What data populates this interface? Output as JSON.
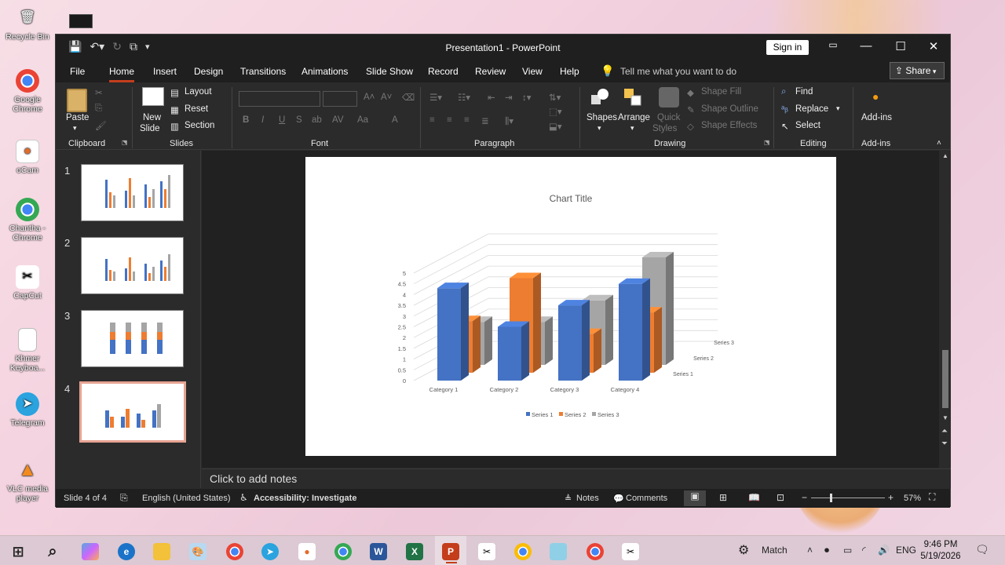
{
  "desktop": {
    "icons": [
      {
        "label": "Recycle Bin",
        "icon": "recycle-bin-icon"
      },
      {
        "label": "Google Chrome",
        "icon": "chrome-icon"
      },
      {
        "label": "oCam",
        "icon": "ocam-icon"
      },
      {
        "label": "Chantha - Chrome",
        "icon": "chrome-profile-icon"
      },
      {
        "label": "CapCut",
        "icon": "capcut-icon"
      },
      {
        "label": "Khmer Keyboa...",
        "icon": "document-icon"
      },
      {
        "label": "Telegram",
        "icon": "telegram-icon"
      },
      {
        "label": "VLC media player",
        "icon": "vlc-icon"
      }
    ]
  },
  "window": {
    "title": "Presentation1  -  PowerPoint",
    "sign_in": "Sign in",
    "share": "Share",
    "tabs": [
      "File",
      "Home",
      "Insert",
      "Design",
      "Transitions",
      "Animations",
      "Slide Show",
      "Record",
      "Review",
      "View",
      "Help"
    ],
    "active_tab": "Home",
    "tell_me": "Tell me what you want to do"
  },
  "ribbon": {
    "clipboard": {
      "paste": "Paste",
      "label": "Clipboard"
    },
    "slides": {
      "new_slide_1": "New",
      "new_slide_2": "Slide",
      "layout": "Layout",
      "reset": "Reset",
      "section": "Section",
      "label": "Slides"
    },
    "font": {
      "label": "Font",
      "buttons": [
        "B",
        "I",
        "U",
        "S",
        "ab",
        "AV",
        "Aa",
        "A"
      ]
    },
    "paragraph": {
      "label": "Paragraph"
    },
    "drawing": {
      "shapes": "Shapes",
      "arrange": "Arrange",
      "quick_styles_1": "Quick",
      "quick_styles_2": "Styles",
      "shape_fill": "Shape Fill",
      "shape_outline": "Shape Outline",
      "shape_effects": "Shape Effects",
      "label": "Drawing"
    },
    "editing": {
      "find": "Find",
      "replace": "Replace",
      "select": "Select",
      "label": "Editing"
    },
    "addins": {
      "button": "Add-ins",
      "label": "Add-ins"
    }
  },
  "slides_panel": {
    "numbers": [
      "1",
      "2",
      "3",
      "4"
    ],
    "selected": 4
  },
  "notes_placeholder": "Click to add notes",
  "status": {
    "slide": "Slide 4 of 4",
    "language": "English (United States)",
    "accessibility": "Accessibility: Investigate",
    "notes": "Notes",
    "comments": "Comments",
    "zoom": "57%"
  },
  "taskbar": {
    "match": "Match",
    "lang": "ENG",
    "time": "9:46 PM",
    "date": "5/19/2026"
  },
  "chart_data": {
    "type": "bar",
    "subtype": "3d-clustered-column",
    "title": "Chart Title",
    "categories": [
      "Category 1",
      "Category 2",
      "Category 3",
      "Category 4"
    ],
    "series": [
      {
        "name": "Series 1",
        "values": [
          4.3,
          2.5,
          3.5,
          4.5
        ],
        "color": "#4472c4"
      },
      {
        "name": "Series 2",
        "values": [
          2.4,
          4.4,
          1.8,
          2.8
        ],
        "color": "#ed7d31"
      },
      {
        "name": "Series 3",
        "values": [
          2,
          2,
          3,
          5
        ],
        "color": "#a5a5a5"
      }
    ],
    "yticks": [
      "0",
      "0.5",
      "1",
      "1.5",
      "2",
      "2.5",
      "3",
      "3.5",
      "4",
      "4.5",
      "5"
    ],
    "ylim": [
      0,
      5
    ],
    "grid": true,
    "legend": "bottom"
  }
}
